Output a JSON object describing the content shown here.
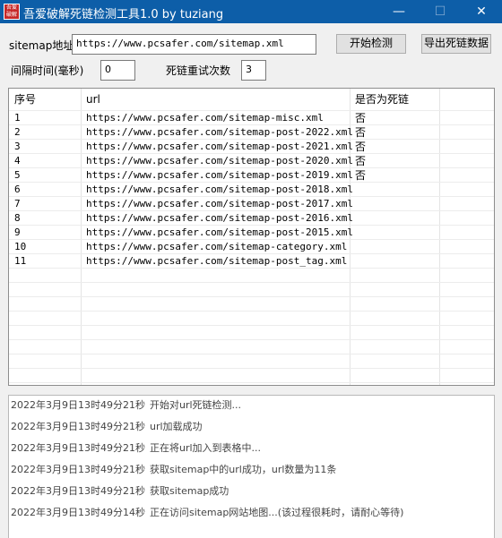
{
  "window": {
    "title": "吾爱破解死链检测工具1.0 by tuziang",
    "icon_text": "吾爱破解",
    "minimize_glyph": "—",
    "maximize_glyph": "☐",
    "close_glyph": "✕"
  },
  "form": {
    "sitemap_label": "sitemap地址",
    "sitemap_value": "https://www.pcsafer.com/sitemap.xml",
    "start_button": "开始检测",
    "export_button": "导出死链数据",
    "interval_label": "间隔时间(毫秒)",
    "interval_value": "0",
    "retry_label": "死链重试次数",
    "retry_value": "3"
  },
  "table": {
    "columns": [
      "序号",
      "url",
      "是否为死链"
    ],
    "rows": [
      {
        "idx": "1",
        "url": "https://www.pcsafer.com/sitemap-misc.xml",
        "dead": "否"
      },
      {
        "idx": "2",
        "url": "https://www.pcsafer.com/sitemap-post-2022.xml",
        "dead": "否"
      },
      {
        "idx": "3",
        "url": "https://www.pcsafer.com/sitemap-post-2021.xml",
        "dead": "否"
      },
      {
        "idx": "4",
        "url": "https://www.pcsafer.com/sitemap-post-2020.xml",
        "dead": "否"
      },
      {
        "idx": "5",
        "url": "https://www.pcsafer.com/sitemap-post-2019.xml",
        "dead": "否"
      },
      {
        "idx": "6",
        "url": "https://www.pcsafer.com/sitemap-post-2018.xml",
        "dead": ""
      },
      {
        "idx": "7",
        "url": "https://www.pcsafer.com/sitemap-post-2017.xml",
        "dead": ""
      },
      {
        "idx": "8",
        "url": "https://www.pcsafer.com/sitemap-post-2016.xml",
        "dead": ""
      },
      {
        "idx": "9",
        "url": "https://www.pcsafer.com/sitemap-post-2015.xml",
        "dead": ""
      },
      {
        "idx": "10",
        "url": "https://www.pcsafer.com/sitemap-category.xml",
        "dead": ""
      },
      {
        "idx": "11",
        "url": "https://www.pcsafer.com/sitemap-post_tag.xml",
        "dead": ""
      }
    ]
  },
  "log": [
    {
      "time": "2022年3月9日13时49分21秒",
      "msg": "开始对url死链检测..."
    },
    {
      "time": "2022年3月9日13时49分21秒",
      "msg": "url加载成功"
    },
    {
      "time": "2022年3月9日13时49分21秒",
      "msg": "正在将url加入到表格中..."
    },
    {
      "time": "2022年3月9日13时49分21秒",
      "msg": "获取sitemap中的url成功，url数量为11条"
    },
    {
      "time": "2022年3月9日13时49分21秒",
      "msg": "获取sitemap成功"
    },
    {
      "time": "2022年3月9日13时49分14秒",
      "msg": "正在访问sitemap网站地图...(该过程很耗时，请耐心等待)"
    }
  ],
  "colors": {
    "titlebar": "#0d5ea8",
    "icon": "#c62828"
  }
}
